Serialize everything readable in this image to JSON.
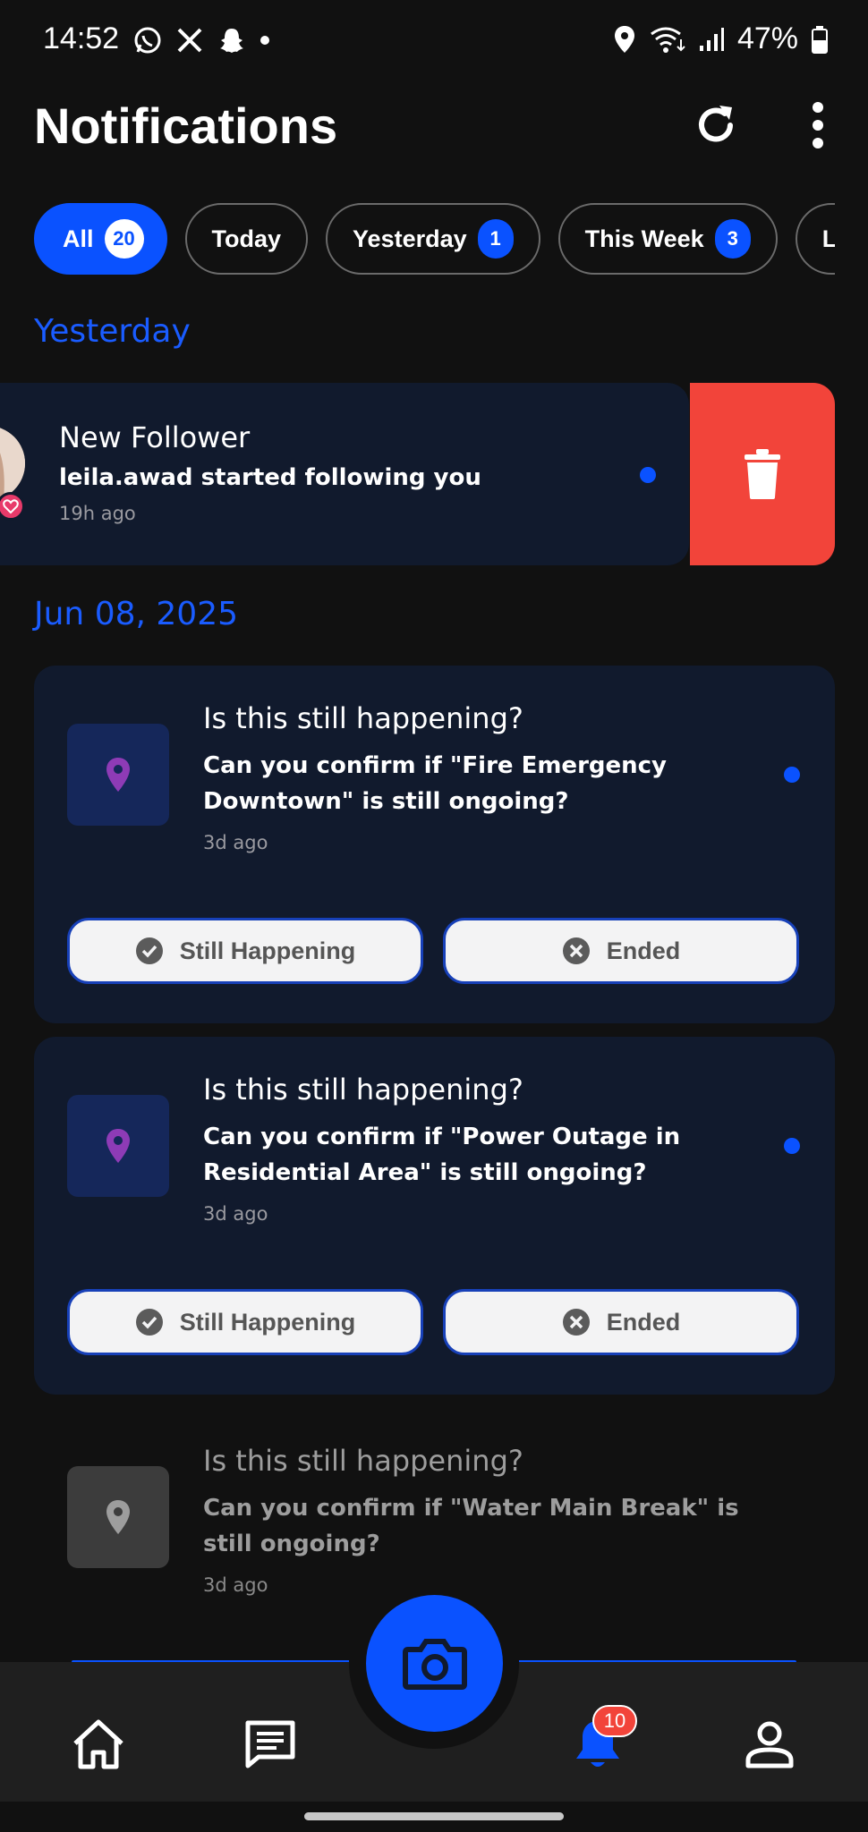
{
  "status_bar": {
    "time": "14:52",
    "battery": "47%",
    "left_icons": [
      "whatsapp-icon",
      "x-icon",
      "snapchat-icon",
      "dot-icon"
    ],
    "right_icons": [
      "location-icon",
      "wifi-icon",
      "signal-icon",
      "battery-icon"
    ]
  },
  "header": {
    "title": "Notifications"
  },
  "filters": [
    {
      "label": "All",
      "count": "20",
      "active": true
    },
    {
      "label": "Today",
      "count": null,
      "active": false
    },
    {
      "label": "Yesterday",
      "count": "1",
      "active": false
    },
    {
      "label": "This Week",
      "count": "3",
      "active": false
    },
    {
      "label": "La",
      "count": null,
      "active": false
    }
  ],
  "sections": {
    "yesterday": "Yesterday",
    "jun": "Jun 08, 2025"
  },
  "follower_notification": {
    "title": "New Follower",
    "body": "leila.awad started following you",
    "time": "19h ago"
  },
  "questions": [
    {
      "title": "Is this still happening?",
      "body": "Can you confirm if \"Fire Emergency Downtown\" is still ongoing?",
      "time": "3d ago",
      "still_label": "Still Happening",
      "ended_label": "Ended"
    },
    {
      "title": "Is this still happening?",
      "body": "Can you confirm if \"Power Outage in Residential Area\" is still ongoing?",
      "time": "3d ago",
      "still_label": "Still Happening",
      "ended_label": "Ended"
    },
    {
      "title": "Is this still happening?",
      "body": "Can you confirm if \"Water Main Break\" is still ongoing?",
      "time": "3d ago"
    }
  ],
  "bottom_nav": {
    "items": [
      "home-icon",
      "messages-icon",
      "camera-icon",
      "bell-icon",
      "profile-icon"
    ],
    "notification_badge": "10"
  },
  "colors": {
    "accent": "#0a52ff",
    "delete": "#f2443a",
    "card": "#111a2d",
    "pin": "#8e3bb6"
  }
}
